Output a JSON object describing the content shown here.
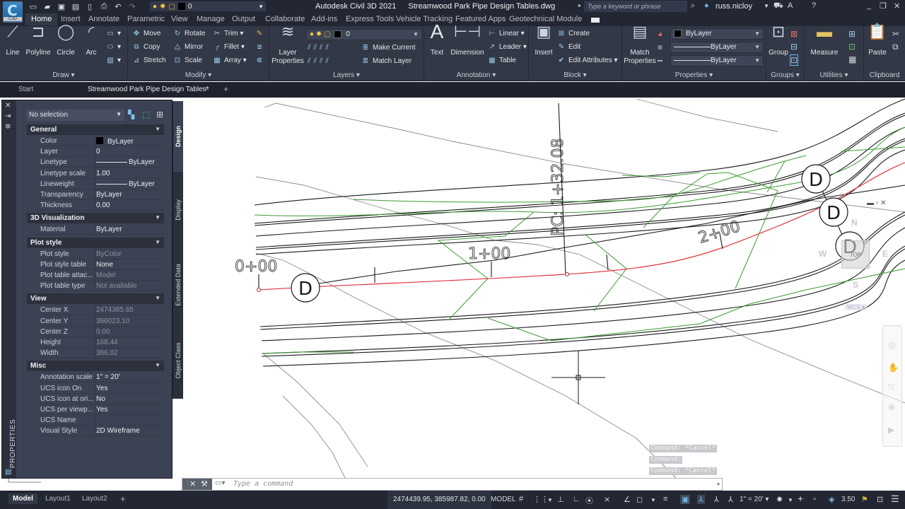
{
  "app": {
    "title": "Autodesk Civil 3D 2021",
    "file": "Streamwood Park Pipe Design Tables.dwg",
    "app_button_label": "C3D",
    "search_placeholder": "Type a keyword or phrase",
    "user": "russ.nicloy",
    "qat_layer_value": "0"
  },
  "ribbon_tabs": [
    "Home",
    "Insert",
    "Annotate",
    "Parametric",
    "View",
    "Manage",
    "Output",
    "Collaborate",
    "Add-ins",
    "Express Tools",
    "Vehicle Tracking",
    "Featured Apps",
    "Geotechnical Module"
  ],
  "ribbon": {
    "draw": {
      "title": "Draw",
      "buttons": [
        "Line",
        "Polyline",
        "Circle",
        "Arc"
      ]
    },
    "modify": {
      "title": "Modify",
      "buttons": [
        "Move",
        "Rotate",
        "Trim",
        "Copy",
        "Mirror",
        "Fillet",
        "Stretch",
        "Scale",
        "Array"
      ]
    },
    "layers": {
      "title": "Layers",
      "layer_properties": "Layer Properties",
      "current_layer": "0",
      "make_current": "Make Current",
      "match_layer": "Match Layer"
    },
    "annotation": {
      "title": "Annotation",
      "text": "Text",
      "dimension": "Dimension",
      "linear": "Linear",
      "leader": "Leader",
      "table": "Table"
    },
    "block": {
      "title": "Block",
      "insert": "Insert",
      "create": "Create",
      "edit": "Edit",
      "edit_attributes": "Edit Attributes"
    },
    "properties": {
      "title": "Properties",
      "match_properties": "Match Properties",
      "color": "ByLayer",
      "lineweight": "ByLayer",
      "linetype": "ByLayer"
    },
    "groups": {
      "title": "Groups",
      "group": "Group"
    },
    "utilities": {
      "title": "Utilities",
      "measure": "Measure"
    },
    "clipboard": {
      "title": "Clipboard",
      "paste": "Paste"
    }
  },
  "doc_tabs": {
    "start": "Start",
    "active": "Streamwood Park Pipe Design Tables*",
    "close": "×",
    "new": "+"
  },
  "properties_palette": {
    "title": "PROPERTIES",
    "selection": "No selection",
    "vertical_tabs": [
      "Design",
      "Display",
      "Extended Data",
      "Object Class"
    ],
    "groups": [
      {
        "name": "General",
        "rows": [
          {
            "key": "Color",
            "value": "ByLayer"
          },
          {
            "key": "Layer",
            "value": "0"
          },
          {
            "key": "Linetype",
            "value": "ByLayer"
          },
          {
            "key": "Linetype scale",
            "value": "1.00"
          },
          {
            "key": "Lineweight",
            "value": "ByLayer"
          },
          {
            "key": "Transparency",
            "value": "ByLayer"
          },
          {
            "key": "Thickness",
            "value": "0.00"
          }
        ]
      },
      {
        "name": "3D Visualization",
        "rows": [
          {
            "key": "Material",
            "value": "ByLayer"
          }
        ]
      },
      {
        "name": "Plot style",
        "rows": [
          {
            "key": "Plot style",
            "value": "ByColor"
          },
          {
            "key": "Plot style table",
            "value": "None"
          },
          {
            "key": "Plot table attac...",
            "value": "Model"
          },
          {
            "key": "Plot table type",
            "value": "Not available"
          }
        ]
      },
      {
        "name": "View",
        "rows": [
          {
            "key": "Center X",
            "value": "2474385.65"
          },
          {
            "key": "Center Y",
            "value": "386023.10"
          },
          {
            "key": "Center Z",
            "value": "0.00"
          },
          {
            "key": "Height",
            "value": "168.44"
          },
          {
            "key": "Width",
            "value": "386.02"
          }
        ]
      },
      {
        "name": "Misc",
        "rows": [
          {
            "key": "Annotation scale",
            "value": "1\" = 20'"
          },
          {
            "key": "UCS icon On",
            "value": "Yes"
          },
          {
            "key": "UCS icon at ori...",
            "value": "No"
          },
          {
            "key": "UCS per viewp...",
            "value": "Yes"
          },
          {
            "key": "UCS Name",
            "value": ""
          },
          {
            "key": "Visual Style",
            "value": "2D Wireframe"
          }
        ]
      }
    ]
  },
  "drawing": {
    "station_labels": [
      "0+00",
      "1+00",
      "2+00",
      "PC: 1+32.08"
    ],
    "structure_label": "D",
    "viewcube": {
      "face": "TOP",
      "north": "N",
      "south": "S",
      "east": "E",
      "west": "W",
      "ucs": "WCS"
    }
  },
  "command_history": [
    "Command: *Cancel*",
    "Command:",
    "Command: *Cancel*"
  ],
  "command_placeholder": "Type a command",
  "layout_tabs": [
    "Model",
    "Layout1",
    "Layout2"
  ],
  "status": {
    "coordinates": "2474439.95, 385987.82, 0.00",
    "space": "MODEL",
    "annotation_scale": "1\" = 20'",
    "zoom_value": "3.50"
  },
  "colors": {
    "ui_dark": "#222733",
    "ribbon": "#323846",
    "palette": "#3b4253",
    "alignment": "#e0363b",
    "green_lines": "#3e9a34",
    "accent": "#6fb8ef"
  }
}
